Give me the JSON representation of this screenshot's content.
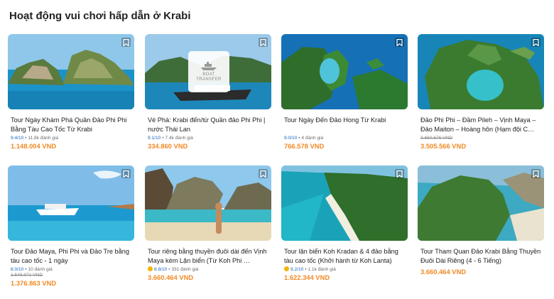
{
  "page": {
    "title": "Hoạt động vui chơi hấp dẫn ở Krabi"
  },
  "cards": [
    {
      "name": "Tour Ngày Khám Phá Quần Đảo Phi Phi Bằng Tàu Cao Tốc Từ Krabi",
      "score": "9.4/10",
      "reviews": "• 11.8k đánh giá",
      "old_price": "",
      "price": "1.148.004 VND",
      "icon": "bookmark-icon"
    },
    {
      "name": "Vé Phà: Krabi đến/từ Quần đảo Phi Phi | nước Thái Lan",
      "score": "9.1/10",
      "reviews": "• 7.4k đánh giá",
      "old_price": "",
      "price": "334.860 VND",
      "icon": "bookmark-icon",
      "badge_line1": "BOAT",
      "badge_line2": "TRANSFER"
    },
    {
      "name": "Tour Ngày Đến Đảo Hong Từ Krabi",
      "score": "9.0/10",
      "reviews": "• 4 đánh giá",
      "old_price": "",
      "price": "766.578 VND",
      "icon": "bookmark-icon"
    },
    {
      "name": "Đảo Phi Phi – Đầm Pileh – Vịnh Maya – Đảo Maiton – Hoàng hôn (Hạm đội C…",
      "score": "",
      "reviews": "",
      "old_price": "3.660.676 VND",
      "price": "3.505.566 VND",
      "icon": "bookmark-icon"
    },
    {
      "name": "Tour Đảo Maya, Phi Phi và Đảo Tre bằng tàu cao tốc - 1 ngày",
      "score": "8.0/10",
      "reviews": "• 10 đánh giá",
      "old_price": "1.548.971 VND",
      "price": "1.376.863 VND",
      "icon": "bookmark-icon"
    },
    {
      "name": "Tour riêng bằng thuyền đuôi dài đến Vịnh Maya kèm Lặn biển (Từ Koh Phi …",
      "score": "8.8/10",
      "reviews": "• 331 đánh giá",
      "old_price": "",
      "price": "3.660.464 VND",
      "icon": "bookmark-icon",
      "google": true
    },
    {
      "name": "Tour lặn biển Koh Kradan & 4 đảo bằng tàu cao tốc (Khởi hành từ Koh Lanta)",
      "score": "9.2/10",
      "reviews": "• 1.1k đánh giá",
      "old_price": "",
      "price": "1.622.344 VND",
      "icon": "bookmark-icon",
      "google": true
    },
    {
      "name": "Tour Tham Quan Đảo Krabi Bằng Thuyền Đuôi Dài Riêng (4 - 6 Tiếng)",
      "score": "",
      "reviews": "",
      "old_price": "",
      "price": "3.660.464 VND",
      "icon": "bookmark-icon"
    }
  ],
  "colors": {
    "price": "#f08a24",
    "score": "#1565c0",
    "sea": "#1e9ed6",
    "jungle": "#3c7d2e"
  }
}
